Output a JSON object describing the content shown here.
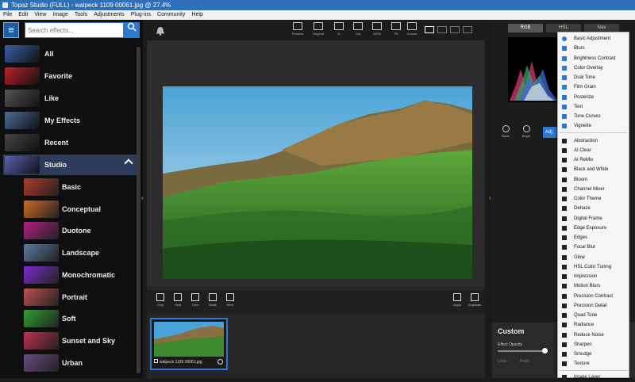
{
  "window": {
    "title": "Topaz Studio (FULL) - walpeck 1109 00061.jpg @ 27.4%"
  },
  "menubar": [
    "File",
    "Edit",
    "View",
    "Image",
    "Tools",
    "Adjustments",
    "Plug-ins",
    "Community",
    "Help"
  ],
  "search": {
    "placeholder": "Search effects...",
    "icon": "search-icon"
  },
  "categories": [
    {
      "label": "All",
      "thumb_color": "#3a5fa8"
    },
    {
      "label": "Favorite",
      "thumb_color": "#c0202a"
    },
    {
      "label": "Like",
      "thumb_color": "#555555"
    },
    {
      "label": "My Effects",
      "thumb_color": "#4a6b9a"
    },
    {
      "label": "Recent",
      "thumb_color": "#444444"
    },
    {
      "label": "Studio",
      "thumb_color": "#5b5fb0"
    }
  ],
  "studio_items": [
    {
      "label": "Basic",
      "thumb_color": "#b33a2a"
    },
    {
      "label": "Conceptual",
      "thumb_color": "#d06a20"
    },
    {
      "label": "Duotone",
      "thumb_color": "#b02080"
    },
    {
      "label": "Landscape",
      "thumb_color": "#5a7aa0"
    },
    {
      "label": "Monochromatic",
      "thumb_color": "#7a2ad0"
    },
    {
      "label": "Portrait",
      "thumb_color": "#c05050"
    },
    {
      "label": "Soft",
      "thumb_color": "#30a030"
    },
    {
      "label": "Sunset and Sky",
      "thumb_color": "#c03050"
    },
    {
      "label": "Urban",
      "thumb_color": "#6a4a80"
    }
  ],
  "top_toolbar": [
    {
      "label": "Preview",
      "icon": "preview-icon"
    },
    {
      "label": "Original",
      "icon": "original-icon"
    },
    {
      "label": "In",
      "icon": "zoom-in-icon"
    },
    {
      "label": "Out",
      "icon": "zoom-out-icon"
    },
    {
      "label": "100%",
      "icon": "actual-size-icon"
    },
    {
      "label": "Fit",
      "icon": "fit-icon"
    },
    {
      "label": "Curves",
      "icon": "curves-icon"
    }
  ],
  "bottom_tools": [
    {
      "label": "Crop",
      "icon": "crop-icon"
    },
    {
      "label": "Heal",
      "icon": "heal-icon"
    },
    {
      "label": "Lens",
      "icon": "lens-icon"
    },
    {
      "label": "Mask",
      "icon": "mask-icon"
    },
    {
      "label": "More",
      "icon": "more-icon"
    }
  ],
  "right_actions": [
    {
      "label": "Apply",
      "icon": "apply-icon"
    },
    {
      "label": "Duplicate",
      "icon": "duplicate-icon"
    }
  ],
  "film": {
    "filename": "walpeck 1109 00061.jpg"
  },
  "histogram_tabs": [
    "RGB",
    "HSL",
    "Nav"
  ],
  "preset_buttons": [
    {
      "label": "Basic",
      "icon": "basic-icon"
    },
    {
      "label": "Bright",
      "icon": "bright-icon"
    }
  ],
  "adj_button": "Adj",
  "custom_panel": {
    "title": "Custom",
    "opacity_label": "Effect Opacity",
    "opacity": 0.95,
    "undo": "Undo",
    "redo": "Redo"
  },
  "adjustments_menu": {
    "group1": [
      "Basic Adjustment",
      "Blurs",
      "Brightness Contrast",
      "Color Overlay",
      "Dual Tone",
      "Film Grain",
      "Posterize",
      "Text",
      "Tone Curves",
      "Vignette"
    ],
    "group2": [
      "Abstraction",
      "AI Clear",
      "AI ReMix",
      "Black and White",
      "Bloom",
      "Channel Mixer",
      "Color Theme",
      "Dehaze",
      "Digital Frame",
      "Edge Exposure",
      "Edges",
      "Focal Blur",
      "Glow",
      "HSL Color Tuning",
      "Impression",
      "Motion Blurs",
      "Precision Contrast",
      "Precision Detail",
      "Quad Tone",
      "Radiance",
      "Reduce Noise",
      "Sharpen",
      "Smudge",
      "Texture"
    ],
    "group3": [
      "Image Layer"
    ]
  }
}
